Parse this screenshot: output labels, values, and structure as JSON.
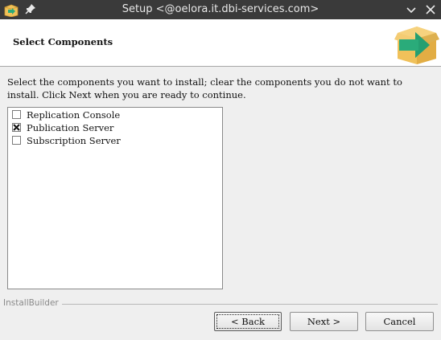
{
  "window": {
    "title": "Setup <@oelora.it.dbi-services.com>",
    "app_icon": "installer-box-icon",
    "pin_icon": "pin-icon",
    "controls": [
      "chevron-down-icon",
      "close-icon"
    ]
  },
  "header": {
    "heading": "Select Components",
    "icon": "box-with-arrow-icon"
  },
  "instructions": "Select the components you want to install; clear the components you do not want to install. Click Next when you are ready to continue.",
  "components": [
    {
      "label": "Replication Console",
      "checked": false
    },
    {
      "label": "Publication Server",
      "checked": true
    },
    {
      "label": "Subscription Server",
      "checked": false
    }
  ],
  "footer": {
    "brand": "InstallBuilder",
    "back_label": "< Back",
    "next_label": "Next >",
    "cancel_label": "Cancel"
  },
  "colors": {
    "titlebar": "#3a3a3a",
    "box": "#f0c15a",
    "arrow": "#2aab7a"
  }
}
